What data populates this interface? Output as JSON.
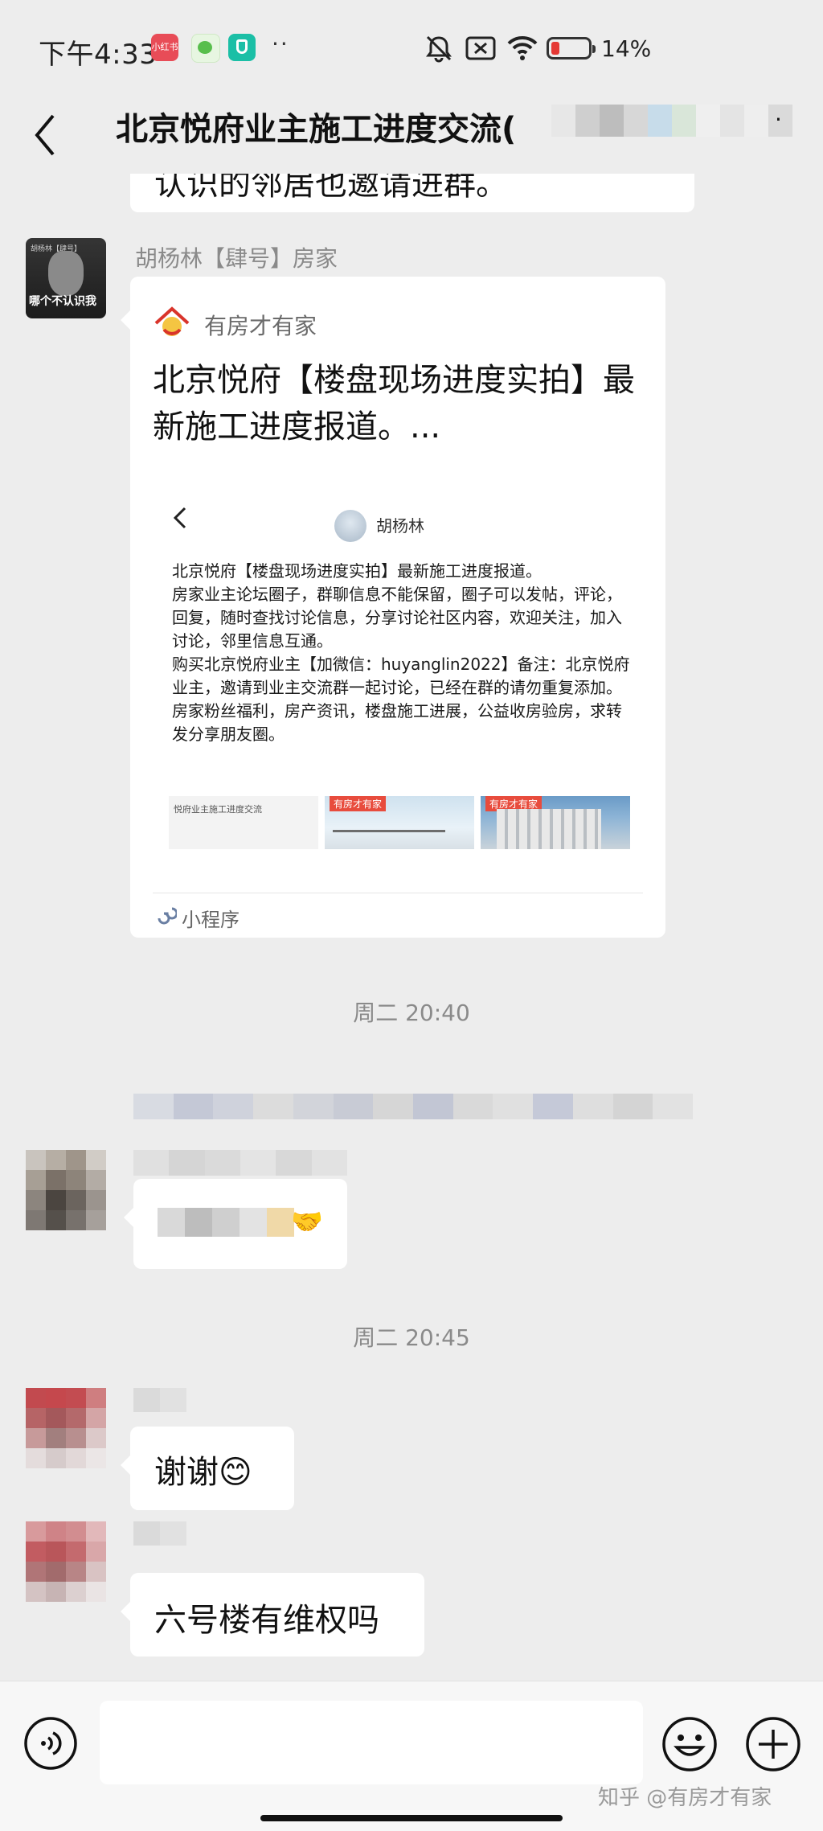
{
  "status_bar": {
    "time": "下午4:33",
    "app_badge": "小红书",
    "dots": "··",
    "battery": "14%"
  },
  "nav": {
    "title": "北京悦府业主施工进度交流(",
    "dot": "·"
  },
  "messages": {
    "partial_text": "认识的邻居也邀请进群。",
    "sender_name": "胡杨林【肆号】房家",
    "avatar_caption_top": "胡杨林【肆号】",
    "avatar_caption_bottom": "哪个不认识我",
    "card": {
      "source": "有房才有家",
      "title": "北京悦府【楼盘现场进度实拍】最新施工进度报道。...",
      "preview_user": "胡杨林",
      "preview_text": "北京悦府【楼盘现场进度实拍】最新施工进度报道。\n房家业主论坛圈子，群聊信息不能保留，圈子可以发帖，评论，回复，随时查找讨论信息，分享讨论社区内容，欢迎关注，加入讨论，邻里信息互通。\n购买北京悦府业主【加微信：huyanglin2022】备注：北京悦府业主，邀请到业主交流群一起讨论，已经在群的请勿重复添加。\n房家粉丝福利，房产资讯，楼盘施工进展，公益收房验房，求转发分享朋友圈。",
      "thumb1_text": "悦府业主施工进度交流",
      "thumb_badge": "有房才有家",
      "mini_program": "小程序"
    },
    "time_1": "周二 20:40",
    "blurred_emoji": "🤝",
    "time_2": "周二 20:45",
    "msg_thanks": "谢谢😊",
    "msg_question": "六号楼有维权吗"
  },
  "watermark": "知乎 @有房才有家",
  "colors": {
    "background": "#ededed",
    "bubble": "#ffffff",
    "meta_text": "#8a8a8a",
    "badge_red": "#e84c3d"
  }
}
